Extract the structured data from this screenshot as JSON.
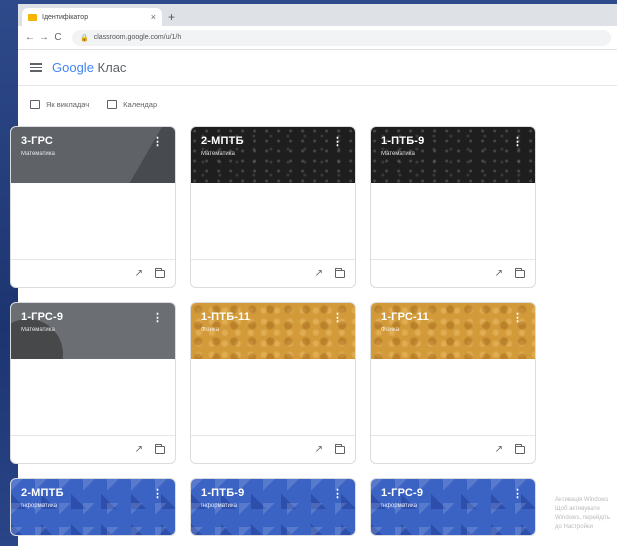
{
  "browser": {
    "tab_title": "Ідентифікатор",
    "tab_close": "×",
    "new_tab": "+",
    "back": "←",
    "forward": "→",
    "reload": "C",
    "lock": "🔒",
    "url": "classroom.google.com/u/1/h"
  },
  "app": {
    "title_prefix": "Google",
    "title_suffix": " Клас"
  },
  "subnav": {
    "items": [
      {
        "label": "Як викладач"
      },
      {
        "label": "Календар"
      }
    ]
  },
  "cards": [
    {
      "name": "3-ГРС",
      "subtitle": "Математика",
      "theme": "gray"
    },
    {
      "name": "2-МПТБ",
      "subtitle": "Математика",
      "theme": "black"
    },
    {
      "name": "1-ПТБ-9",
      "subtitle": "Математика",
      "theme": "black"
    },
    {
      "name": "1-ГРС-9",
      "subtitle": "Математика",
      "theme": "gray2"
    },
    {
      "name": "1-ПТБ-11",
      "subtitle": "Фізика",
      "theme": "orange"
    },
    {
      "name": "1-ГРС-11",
      "subtitle": "Фізика",
      "theme": "orange"
    },
    {
      "name": "2-МПТБ",
      "subtitle": "Інформатика",
      "theme": "blue"
    },
    {
      "name": "1-ПТБ-9",
      "subtitle": "Інформатика",
      "theme": "blue"
    },
    {
      "name": "1-ГРС-9",
      "subtitle": "Інформатика",
      "theme": "blue"
    }
  ],
  "card_more": "⋮",
  "card_trend": "↗",
  "watermark": "Активація Windows Щоб активувати Windows, перейдіть до Настройки"
}
